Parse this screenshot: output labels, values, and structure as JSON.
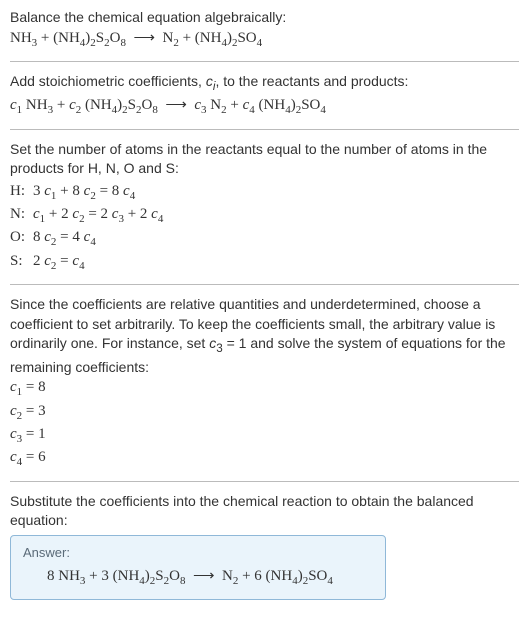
{
  "step1": {
    "text": "Balance the chemical equation algebraically:",
    "equation": "NH<sub>3</sub> + (NH<sub>4</sub>)<sub>2</sub>S<sub>2</sub>O<sub>8</sub> &nbsp;⟶&nbsp; N<sub>2</sub> + (NH<sub>4</sub>)<sub>2</sub>SO<sub>4</sub>"
  },
  "step2": {
    "text_html": "Add stoichiometric coefficients, <span class='ital'>c<sub>i</sub></span>, to the reactants and products:",
    "equation": "<span class='ital'>c</span><sub>1</sub> NH<sub>3</sub> + <span class='ital'>c</span><sub>2</sub> (NH<sub>4</sub>)<sub>2</sub>S<sub>2</sub>O<sub>8</sub> &nbsp;⟶&nbsp; <span class='ital'>c</span><sub>3</sub> N<sub>2</sub> + <span class='ital'>c</span><sub>4</sub> (NH<sub>4</sub>)<sub>2</sub>SO<sub>4</sub>"
  },
  "step3": {
    "text": "Set the number of atoms in the reactants equal to the number of atoms in the products for H, N, O and S:",
    "rows": [
      {
        "label": "H:",
        "eq": "3 <span class='ital'>c</span><sub>1</sub> + 8 <span class='ital'>c</span><sub>2</sub> = 8 <span class='ital'>c</span><sub>4</sub>"
      },
      {
        "label": "N:",
        "eq": "<span class='ital'>c</span><sub>1</sub> + 2 <span class='ital'>c</span><sub>2</sub> = 2 <span class='ital'>c</span><sub>3</sub> + 2 <span class='ital'>c</span><sub>4</sub>"
      },
      {
        "label": "O:",
        "eq": "8 <span class='ital'>c</span><sub>2</sub> = 4 <span class='ital'>c</span><sub>4</sub>"
      },
      {
        "label": "S:",
        "eq": "2 <span class='ital'>c</span><sub>2</sub> = <span class='ital'>c</span><sub>4</sub>"
      }
    ]
  },
  "step4": {
    "text_html": "Since the coefficients are relative quantities and underdetermined, choose a coefficient to set arbitrarily. To keep the coefficients small, the arbitrary value is ordinarily one. For instance, set <span class='ital'>c</span><sub>3</sub> = 1 and solve the system of equations for the remaining coefficients:",
    "rows": [
      {
        "eq": "<span class='ital'>c</span><sub>1</sub> = 8"
      },
      {
        "eq": "<span class='ital'>c</span><sub>2</sub> = 3"
      },
      {
        "eq": "<span class='ital'>c</span><sub>3</sub> = 1"
      },
      {
        "eq": "<span class='ital'>c</span><sub>4</sub> = 6"
      }
    ]
  },
  "step5": {
    "text": "Substitute the coefficients into the chemical reaction to obtain the balanced equation:"
  },
  "answer": {
    "label": "Answer:",
    "equation": "8 NH<sub>3</sub> + 3 (NH<sub>4</sub>)<sub>2</sub>S<sub>2</sub>O<sub>8</sub> &nbsp;⟶&nbsp; N<sub>2</sub> + 6 (NH<sub>4</sub>)<sub>2</sub>SO<sub>4</sub>"
  },
  "chart_data": {
    "type": "table",
    "title": "Balanced chemical equation derivation",
    "unbalanced_equation": "NH3 + (NH4)2S2O8 -> N2 + (NH4)2SO4",
    "element_balance": [
      {
        "element": "H",
        "equation": "3 c1 + 8 c2 = 8 c4"
      },
      {
        "element": "N",
        "equation": "c1 + 2 c2 = 2 c3 + 2 c4"
      },
      {
        "element": "O",
        "equation": "8 c2 = 4 c4"
      },
      {
        "element": "S",
        "equation": "2 c2 = c4"
      }
    ],
    "arbitrary_set": {
      "coefficient": "c3",
      "value": 1
    },
    "solution": {
      "c1": 8,
      "c2": 3,
      "c3": 1,
      "c4": 6
    },
    "balanced_equation": "8 NH3 + 3 (NH4)2S2O8 -> N2 + 6 (NH4)2SO4"
  }
}
